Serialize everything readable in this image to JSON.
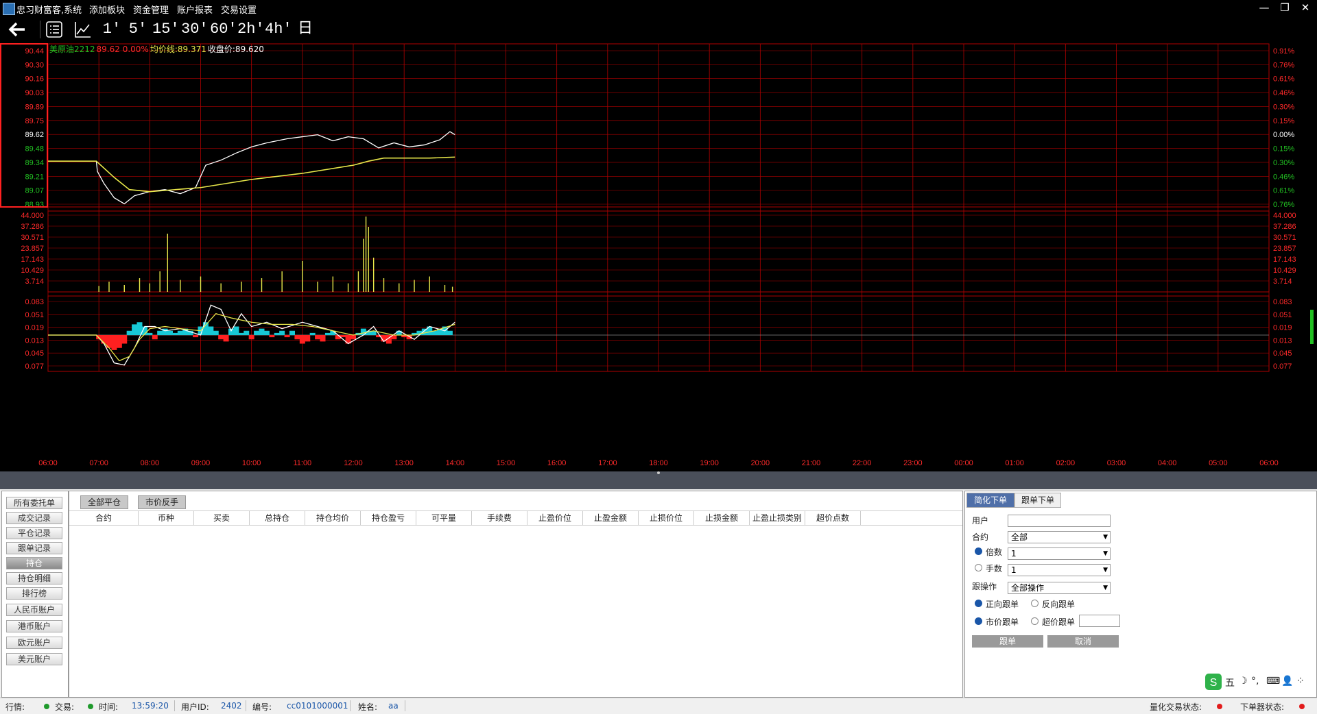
{
  "window": {
    "title": "忠习财富客,系统",
    "menu": [
      "添加板块",
      "资金管理",
      "账户报表",
      "交易设置"
    ],
    "controls": {
      "minimize": "—",
      "restore": "❐",
      "close": "✕"
    }
  },
  "toolbar": {
    "back_icon": "back-arrow-icon",
    "list_icon": "list-icon",
    "chart_icon": "line-chart-icon",
    "periods": [
      "1'",
      "5'",
      "15'",
      "30'",
      "60'",
      "2h'",
      "4h'",
      "日"
    ]
  },
  "chart": {
    "legend": {
      "symbol": "美原油2212",
      "price_change": "89.62 0.00%",
      "avg_line": "均价线:89.371",
      "close": "收盘价:89.620"
    },
    "colors": {
      "up": "#ff2a2a",
      "down": "#22c022",
      "current": "#ffffff",
      "avg": "#e8e84a",
      "grid": "#b00000",
      "macd_pos": "#17c9d6",
      "macd_neg": "#ff2020"
    }
  },
  "chart_data": [
    {
      "type": "line",
      "panel": "price",
      "ylim": [
        88.93,
        90.44
      ],
      "price_labels": [
        "90.44",
        "90.30",
        "90.16",
        "90.03",
        "89.89",
        "89.75",
        "89.62",
        "89.48",
        "89.34",
        "89.21",
        "89.07",
        "88.93"
      ],
      "pct_labels": [
        "0.91%",
        "0.76%",
        "0.61%",
        "0.46%",
        "0.30%",
        "0.15%",
        "0.00%",
        "0.15%",
        "0.30%",
        "0.46%",
        "0.61%",
        "0.76%"
      ],
      "x_labels": [
        "06:00",
        "07:00",
        "08:00",
        "09:00",
        "10:00",
        "11:00",
        "12:00",
        "13:00",
        "14:00",
        "15:00",
        "16:00",
        "17:00",
        "18:00",
        "19:00",
        "20:00",
        "21:00",
        "22:00",
        "23:00",
        "00:00",
        "01:00",
        "02:00",
        "03:00",
        "04:00",
        "05:00",
        "06:00"
      ],
      "series": [
        {
          "name": "",
          "color": "#ffffff",
          "x": [
            0,
            0.95,
            0.97,
            1.1,
            1.3,
            1.5,
            1.7,
            2.0,
            2.3,
            2.6,
            2.9,
            3.1,
            3.4,
            3.7,
            4.0,
            4.3,
            4.7,
            5.0,
            5.3,
            5.6,
            5.9,
            6.2,
            6.5,
            6.8,
            7.1,
            7.4,
            7.7,
            7.9,
            8.0
          ],
          "values": [
            89.34,
            89.34,
            89.24,
            89.12,
            88.98,
            88.92,
            89.0,
            89.04,
            89.06,
            89.02,
            89.08,
            89.3,
            89.35,
            89.42,
            89.48,
            89.52,
            89.56,
            89.58,
            89.6,
            89.54,
            89.58,
            89.56,
            89.47,
            89.52,
            89.48,
            89.5,
            89.55,
            89.63,
            89.6
          ]
        },
        {
          "name": "",
          "color": "#e8e84a",
          "x": [
            0,
            0.95,
            1.3,
            1.6,
            2.0,
            3.0,
            4.0,
            5.0,
            6.0,
            6.3,
            6.6,
            7.0,
            7.5,
            8.0
          ],
          "values": [
            89.34,
            89.34,
            89.18,
            89.06,
            89.04,
            89.08,
            89.16,
            89.22,
            89.3,
            89.34,
            89.37,
            89.37,
            89.37,
            89.38
          ]
        }
      ]
    },
    {
      "type": "bar",
      "panel": "volume",
      "ylim": [
        0,
        44.0
      ],
      "y_labels": [
        "44.000",
        "37.286",
        "30.571",
        "23.857",
        "17.143",
        "10.429",
        "3.714"
      ],
      "x": [
        1.0,
        1.2,
        1.5,
        1.8,
        2.0,
        2.2,
        2.35,
        2.6,
        3.0,
        3.4,
        3.8,
        4.2,
        4.6,
        5.0,
        5.3,
        5.6,
        5.9,
        6.1,
        6.2,
        6.25,
        6.3,
        6.4,
        6.6,
        6.9,
        7.2,
        7.5,
        7.8,
        7.95
      ],
      "values": [
        3.5,
        6.0,
        4.0,
        8.0,
        5.0,
        12.0,
        34.0,
        7.0,
        9.0,
        5.0,
        6.0,
        8.0,
        12.0,
        18.0,
        6.0,
        9.0,
        5.0,
        12.0,
        31.0,
        44.0,
        38.0,
        20.0,
        8.0,
        5.0,
        7.0,
        9.0,
        4.0,
        3.0
      ]
    },
    {
      "type": "line",
      "panel": "macd",
      "ylim": [
        -0.077,
        0.083
      ],
      "y_labels": [
        "0.083",
        "0.051",
        "0.019",
        "0.013",
        "0.045",
        "0.077"
      ],
      "series": [
        {
          "name": "",
          "color": "#ffffff",
          "x": [
            0,
            0.95,
            1.1,
            1.3,
            1.5,
            1.7,
            1.9,
            2.1,
            2.3,
            2.6,
            3.0,
            3.2,
            3.4,
            3.6,
            3.8,
            4.0,
            4.3,
            4.6,
            5.0,
            5.3,
            5.6,
            5.9,
            6.2,
            6.4,
            6.6,
            6.9,
            7.2,
            7.5,
            7.8,
            8.0
          ],
          "values": [
            0,
            0,
            -0.02,
            -0.065,
            -0.07,
            -0.03,
            0.02,
            0.02,
            0.01,
            0.015,
            0.0,
            0.07,
            0.06,
            0.01,
            0.05,
            0.02,
            0.03,
            0.015,
            0.03,
            0.02,
            0.01,
            -0.02,
            0.0,
            0.02,
            -0.015,
            0.01,
            -0.01,
            0.02,
            0.01,
            0.03
          ]
        },
        {
          "name": "",
          "color": "#e8e84a",
          "x": [
            0,
            0.95,
            1.2,
            1.4,
            1.6,
            1.8,
            2.0,
            2.3,
            2.6,
            3.0,
            3.3,
            3.6,
            4.0,
            4.4,
            4.8,
            5.2,
            5.6,
            6.0,
            6.4,
            6.8,
            7.2,
            7.6,
            8.0
          ],
          "values": [
            0,
            0,
            -0.03,
            -0.06,
            -0.05,
            -0.01,
            0.015,
            0.02,
            0.015,
            0.01,
            0.05,
            0.04,
            0.03,
            0.025,
            0.025,
            0.02,
            0.01,
            0.0,
            0.01,
            0.0,
            0.0,
            0.01,
            0.025
          ]
        }
      ],
      "histogram": {
        "x": [
          1.0,
          1.1,
          1.2,
          1.3,
          1.4,
          1.5,
          1.6,
          1.7,
          1.8,
          1.9,
          2.0,
          2.1,
          2.2,
          2.3,
          2.4,
          2.5,
          2.6,
          2.7,
          2.8,
          2.9,
          3.0,
          3.1,
          3.2,
          3.3,
          3.4,
          3.5,
          3.6,
          3.7,
          3.8,
          3.9,
          4.0,
          4.1,
          4.2,
          4.3,
          4.4,
          4.5,
          4.6,
          4.7,
          4.8,
          4.9,
          5.0,
          5.1,
          5.2,
          5.3,
          5.4,
          5.5,
          5.6,
          5.7,
          5.8,
          5.9,
          6.0,
          6.1,
          6.2,
          6.3,
          6.4,
          6.5,
          6.6,
          6.7,
          6.8,
          6.9,
          7.0,
          7.1,
          7.2,
          7.3,
          7.4,
          7.5,
          7.6,
          7.7,
          7.8,
          7.9
        ],
        "values": [
          -0.01,
          -0.02,
          -0.03,
          -0.035,
          -0.03,
          -0.02,
          0.01,
          0.025,
          0.03,
          0.02,
          0.005,
          -0.01,
          0.01,
          0.015,
          0.01,
          0.005,
          0.01,
          0.015,
          0.01,
          -0.005,
          0.02,
          0.03,
          0.02,
          0.01,
          -0.01,
          -0.015,
          0.015,
          0.02,
          0.005,
          0.01,
          -0.01,
          0.01,
          0.015,
          0.01,
          -0.005,
          0.005,
          0.01,
          -0.005,
          0.01,
          -0.01,
          -0.02,
          -0.015,
          0.005,
          -0.01,
          -0.015,
          0.005,
          0.01,
          -0.01,
          -0.005,
          -0.02,
          -0.01,
          0.005,
          0.015,
          0.01,
          0.01,
          -0.005,
          -0.015,
          -0.02,
          -0.01,
          0.01,
          -0.005,
          -0.01,
          0.005,
          0.01,
          0.015,
          0.02,
          0.01,
          0.015,
          0.02,
          0.01
        ]
      }
    }
  ],
  "left_nav": {
    "items": [
      "所有委托单",
      "成交记录",
      "平仓记录",
      "跟单记录",
      "持仓",
      "持仓明细",
      "排行榜",
      "人民币账户",
      "港币账户",
      "欧元账户",
      "美元账户"
    ],
    "active": "持仓"
  },
  "positions": {
    "buttons": [
      "全部平仓",
      "市价反手"
    ],
    "columns": [
      "合约",
      "币种",
      "买卖",
      "总持仓",
      "持仓均价",
      "持仓盈亏",
      "可平量",
      "手续费",
      "止盈价位",
      "止盈金额",
      "止损价位",
      "止损金额",
      "止盈止损类别",
      "超价点数"
    ]
  },
  "order_panel": {
    "tabs": [
      "简化下单",
      "跟单下单"
    ],
    "user_label": "用户",
    "user_value": "",
    "contract_label": "合约",
    "contract_value": "全部",
    "multiplier_label": "倍数",
    "multiplier_value": "1",
    "lots_label": "手数",
    "lots_value": "1",
    "follow_op_label": "跟操作",
    "follow_op_value": "全部操作",
    "forward_label": "正向跟单",
    "reverse_label": "反向跟单",
    "market_label": "市价跟单",
    "over_price_label": "超价跟单",
    "over_price_value": "",
    "follow_button": "跟单",
    "cancel_button": "取消"
  },
  "ime": {
    "label": "五",
    "moon": "☽",
    "dot": "°,",
    "keyboard": "⌨",
    "user": "👤",
    "grid": "⁘"
  },
  "status": {
    "market_label": "行情:",
    "trade_label": "交易:",
    "time_label": "时间:",
    "time_value": "13:59:20",
    "userid_label": "用户ID:",
    "userid_value": "2402",
    "code_label": "编号:",
    "code_value": "cc0101000001",
    "name_label": "姓名:",
    "name_value": "aa",
    "quant_label": "量化交易状态:",
    "order_label": "下单器状态:",
    "market_dot_color": "#1f9a2c",
    "trade_dot_color": "#1f9a2c",
    "quant_dot_color": "#e21b1b",
    "order_dot_color": "#e21b1b"
  }
}
